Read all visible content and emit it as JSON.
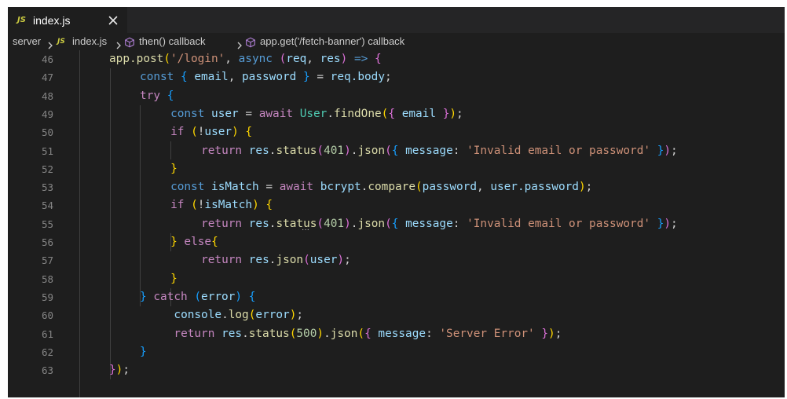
{
  "tab": {
    "icon_label": "JS",
    "title": "index.js",
    "close_glyph": "✕"
  },
  "breadcrumb": {
    "folder": "server",
    "file_icon_label": "JS",
    "file": "index.js",
    "symbol1": "then() callback",
    "symbol2": "app.get('/fetch-banner') callback"
  },
  "icons": {
    "tab_file": "js-file-icon",
    "close": "close-icon",
    "separator": "chevron-right-icon",
    "symbol": "method-cube-icon"
  },
  "colors": {
    "editor_bg": "#1e1e1e",
    "keyword": "#569cd6",
    "control": "#c586c0",
    "function": "#dcdcaa",
    "variable": "#9cdcfe",
    "string": "#ce9178",
    "number": "#b5cea8",
    "class": "#4ec9b0",
    "bracket_1": "#ffd700",
    "bracket_2": "#da70d6",
    "bracket_3": "#179fff"
  },
  "lines": [
    {
      "n": "46",
      "tokens": [
        [
          "fn",
          "app.post"
        ],
        [
          "b1",
          "("
        ],
        [
          "str",
          "'/login'"
        ],
        [
          "op",
          ", "
        ],
        [
          "kw",
          "async "
        ],
        [
          "b2",
          "("
        ],
        [
          "var",
          "req"
        ],
        [
          "op",
          ", "
        ],
        [
          "var",
          "res"
        ],
        [
          "b2",
          ")"
        ],
        [
          "op",
          " "
        ],
        [
          "kw",
          "=>"
        ],
        [
          "op",
          " "
        ],
        [
          "b2",
          "{"
        ]
      ]
    },
    {
      "n": "47",
      "tokens": [
        [
          "kw",
          "const "
        ],
        [
          "b3",
          "{"
        ],
        [
          "op",
          " "
        ],
        [
          "var",
          "email"
        ],
        [
          "op",
          ", "
        ],
        [
          "var",
          "password"
        ],
        [
          "op",
          " "
        ],
        [
          "b3",
          "}"
        ],
        [
          "op",
          " = "
        ],
        [
          "var",
          "req.body"
        ],
        [
          "op",
          ";"
        ]
      ]
    },
    {
      "n": "48",
      "tokens": [
        [
          "ctl",
          "try "
        ],
        [
          "b3",
          "{"
        ]
      ]
    },
    {
      "n": "49",
      "tokens": [
        [
          "kw",
          "const "
        ],
        [
          "var",
          "user"
        ],
        [
          "op",
          " = "
        ],
        [
          "ctl",
          "await "
        ],
        [
          "cls",
          "User"
        ],
        [
          "op",
          "."
        ],
        [
          "fn",
          "findOne"
        ],
        [
          "b1",
          "("
        ],
        [
          "b2",
          "{"
        ],
        [
          "op",
          " "
        ],
        [
          "var",
          "email"
        ],
        [
          "op",
          " "
        ],
        [
          "b2",
          "}"
        ],
        [
          "b1",
          ")"
        ],
        [
          "op",
          ";"
        ]
      ]
    },
    {
      "n": "50",
      "tokens": [
        [
          "ctl",
          "if "
        ],
        [
          "b1",
          "("
        ],
        [
          "op",
          "!"
        ],
        [
          "var",
          "user"
        ],
        [
          "b1",
          ")"
        ],
        [
          "op",
          " "
        ],
        [
          "b1",
          "{"
        ]
      ]
    },
    {
      "n": "51",
      "tokens": [
        [
          "ctl",
          "return "
        ],
        [
          "var",
          "res"
        ],
        [
          "op",
          "."
        ],
        [
          "fn",
          "status"
        ],
        [
          "b2",
          "("
        ],
        [
          "num",
          "401"
        ],
        [
          "b2",
          ")"
        ],
        [
          "op",
          "."
        ],
        [
          "fn",
          "json"
        ],
        [
          "b2",
          "("
        ],
        [
          "b3",
          "{"
        ],
        [
          "op",
          " "
        ],
        [
          "var",
          "message"
        ],
        [
          "op",
          ": "
        ],
        [
          "str",
          "'Invalid email or password'"
        ],
        [
          "op",
          " "
        ],
        [
          "b3",
          "}"
        ],
        [
          "b2",
          ")"
        ],
        [
          "op",
          ";"
        ]
      ]
    },
    {
      "n": "52",
      "tokens": [
        [
          "b1",
          "}"
        ]
      ]
    },
    {
      "n": "53",
      "tokens": [
        [
          "kw",
          "const "
        ],
        [
          "var",
          "isMatch"
        ],
        [
          "op",
          " = "
        ],
        [
          "ctl",
          "await "
        ],
        [
          "var",
          "bcrypt"
        ],
        [
          "op",
          "."
        ],
        [
          "fn",
          "compare"
        ],
        [
          "b1",
          "("
        ],
        [
          "var",
          "password"
        ],
        [
          "op",
          ", "
        ],
        [
          "var",
          "user.password"
        ],
        [
          "b1",
          ")"
        ],
        [
          "op",
          ";"
        ]
      ]
    },
    {
      "n": "54",
      "tokens": [
        [
          "ctl",
          "if "
        ],
        [
          "b1",
          "("
        ],
        [
          "op",
          "!"
        ],
        [
          "var",
          "isMatch"
        ],
        [
          "b1",
          ")"
        ],
        [
          "op",
          " "
        ],
        [
          "b1",
          "{"
        ]
      ]
    },
    {
      "n": "55",
      "tokens": [
        [
          "ctl",
          "return "
        ],
        [
          "var",
          "res"
        ],
        [
          "op",
          "."
        ],
        [
          "fn",
          "status"
        ],
        [
          "b2",
          "("
        ],
        [
          "num",
          "401"
        ],
        [
          "b2",
          ")"
        ],
        [
          "op",
          "."
        ],
        [
          "fn",
          "json"
        ],
        [
          "b2",
          "("
        ],
        [
          "b3",
          "{"
        ],
        [
          "op",
          " "
        ],
        [
          "var",
          "message"
        ],
        [
          "op",
          ": "
        ],
        [
          "str",
          "'Invalid email or password'"
        ],
        [
          "op",
          " "
        ],
        [
          "b3",
          "}"
        ],
        [
          "b2",
          ")"
        ],
        [
          "op",
          ";"
        ]
      ]
    },
    {
      "n": "56",
      "tokens": [
        [
          "b1",
          "}"
        ],
        [
          "op",
          " "
        ],
        [
          "ctl",
          "else"
        ],
        [
          "b1",
          "{"
        ]
      ]
    },
    {
      "n": "57",
      "tokens": [
        [
          "ctl",
          "return "
        ],
        [
          "var",
          "res"
        ],
        [
          "op",
          "."
        ],
        [
          "fn",
          "json"
        ],
        [
          "b2",
          "("
        ],
        [
          "var",
          "user"
        ],
        [
          "b2",
          ")"
        ],
        [
          "op",
          ";"
        ]
      ]
    },
    {
      "n": "58",
      "tokens": [
        [
          "b1",
          "}"
        ]
      ]
    },
    {
      "n": "59",
      "tokens": [
        [
          "b3",
          "}"
        ],
        [
          "op",
          " "
        ],
        [
          "ctl",
          "catch "
        ],
        [
          "b3",
          "("
        ],
        [
          "var",
          "error"
        ],
        [
          "b3",
          ")"
        ],
        [
          "op",
          " "
        ],
        [
          "b3",
          "{"
        ]
      ]
    },
    {
      "n": "60",
      "tokens": [
        [
          "var",
          "console"
        ],
        [
          "op",
          "."
        ],
        [
          "fn",
          "log"
        ],
        [
          "b1",
          "("
        ],
        [
          "var",
          "error"
        ],
        [
          "b1",
          ")"
        ],
        [
          "op",
          ";"
        ]
      ]
    },
    {
      "n": "61",
      "tokens": [
        [
          "ctl",
          "return "
        ],
        [
          "var",
          "res"
        ],
        [
          "op",
          "."
        ],
        [
          "fn",
          "status"
        ],
        [
          "b1",
          "("
        ],
        [
          "num",
          "500"
        ],
        [
          "b1",
          ")"
        ],
        [
          "op",
          "."
        ],
        [
          "fn",
          "json"
        ],
        [
          "b1",
          "("
        ],
        [
          "b2",
          "{"
        ],
        [
          "op",
          " "
        ],
        [
          "var",
          "message"
        ],
        [
          "op",
          ": "
        ],
        [
          "str",
          "'Server Error'"
        ],
        [
          "op",
          " "
        ],
        [
          "b2",
          "}"
        ],
        [
          "b1",
          ")"
        ],
        [
          "op",
          ";"
        ]
      ]
    },
    {
      "n": "62",
      "tokens": [
        [
          "b3",
          "}"
        ]
      ]
    },
    {
      "n": "63",
      "tokens": [
        [
          "b2",
          "}"
        ],
        [
          "b1",
          ")"
        ],
        [
          "op",
          ";"
        ]
      ]
    }
  ]
}
